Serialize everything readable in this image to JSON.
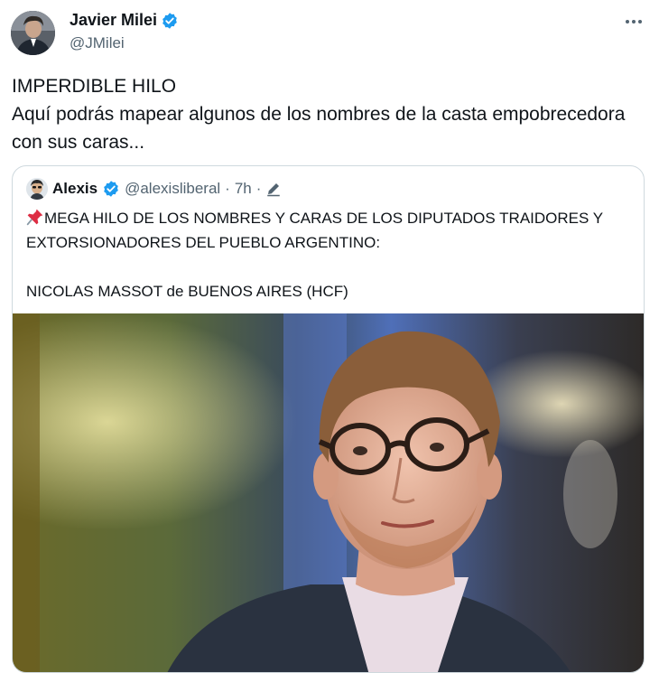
{
  "author": {
    "name": "Javier Milei",
    "handle": "@JMilei",
    "verified_color": "#1d9bf0"
  },
  "tweet": {
    "line1": "IMPERDIBLE HILO",
    "line2": "Aquí podrás mapear algunos de los nombres de la casta empobrecedora con sus caras..."
  },
  "quoted": {
    "name": "Alexis",
    "handle": "@alexisliberal",
    "separator": "·",
    "time": "7h",
    "separator2": "·",
    "pin_icon": "pushpin-icon",
    "text_line1": "MEGA HILO DE LOS NOMBRES Y CARAS DE LOS DIPUTADOS TRAIDORES Y EXTORSIONADORES DEL PUEBLO ARGENTINO:",
    "text_line2": "NICOLAS MASSOT de BUENOS AIRES (HCF)"
  },
  "icons": [
    "verified-badge-icon",
    "more-options-icon",
    "edit-pencil-icon",
    "pushpin-icon"
  ]
}
